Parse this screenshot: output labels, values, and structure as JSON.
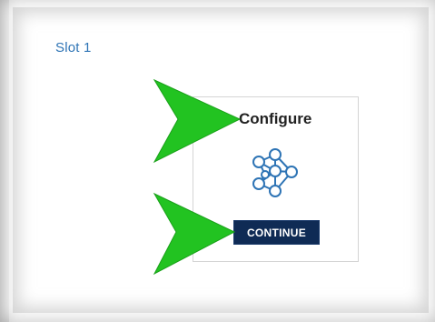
{
  "slot": {
    "label": "Slot 1"
  },
  "card": {
    "title": "Configure",
    "icon": "neural-network-icon",
    "button_label": "CONTINUE"
  },
  "annotations": {
    "arrow_color": "#22c321",
    "arrow_icon": "pointer-arrow-icon"
  },
  "colors": {
    "slot_label": "#2e74b5",
    "button_bg": "#0f2b55",
    "icon_stroke": "#2e74b5"
  }
}
